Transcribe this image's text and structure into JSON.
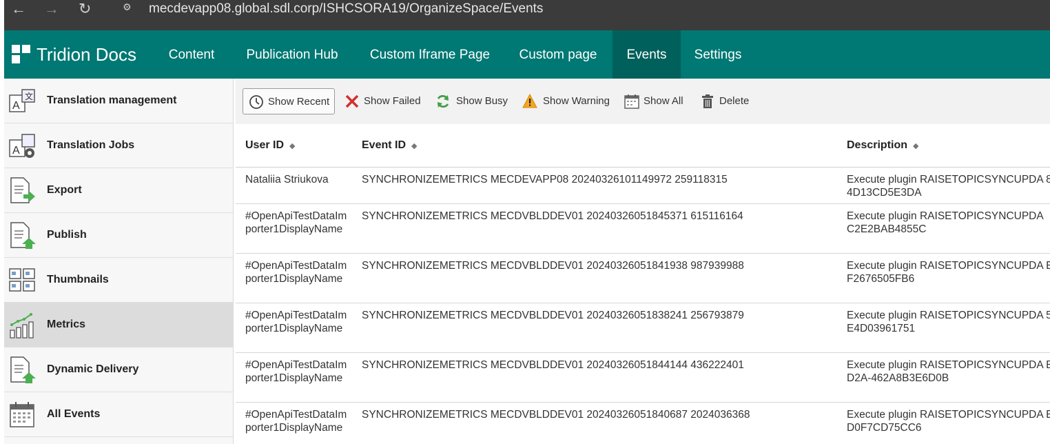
{
  "browser": {
    "url": "mecdevapp08.global.sdl.corp/ISHCSORA19/OrganizeSpace/Events",
    "back_icon": "arrow-left-icon",
    "forward_icon": "arrow-right-icon",
    "reload_icon": "reload-icon"
  },
  "header": {
    "brand": "Tridion Docs",
    "accent": "#007873",
    "active_tab_color": "#00605c",
    "tabs": [
      {
        "label": "Content"
      },
      {
        "label": "Publication Hub"
      },
      {
        "label": "Custom Iframe Page"
      },
      {
        "label": "Custom page"
      },
      {
        "label": "Events",
        "active": true
      },
      {
        "label": "Settings"
      }
    ]
  },
  "sidebar": {
    "items": [
      {
        "label": "Translation management",
        "icon": "translation-icon"
      },
      {
        "label": "Translation Jobs",
        "icon": "translation-jobs-icon"
      },
      {
        "label": "Export",
        "icon": "export-icon"
      },
      {
        "label": "Publish",
        "icon": "publish-icon"
      },
      {
        "label": "Thumbnails",
        "icon": "thumbnails-icon"
      },
      {
        "label": "Metrics",
        "icon": "metrics-icon",
        "active": true
      },
      {
        "label": "Dynamic Delivery",
        "icon": "dynamic-delivery-icon"
      },
      {
        "label": "All Events",
        "icon": "calendar-icon"
      }
    ]
  },
  "toolbar": {
    "buttons": [
      {
        "label": "Show Recent",
        "icon": "clock-icon",
        "selected": true
      },
      {
        "label": "Show Failed",
        "icon": "x-icon"
      },
      {
        "label": "Show Busy",
        "icon": "refresh-icon"
      },
      {
        "label": "Show Warning",
        "icon": "warning-icon"
      },
      {
        "label": "Show All",
        "icon": "calendar-icon"
      },
      {
        "label": "Delete",
        "icon": "trash-icon"
      }
    ]
  },
  "table": {
    "columns": [
      "User ID",
      "Event ID",
      "Description"
    ],
    "rows": [
      {
        "user": "Nataliia Striukova",
        "event": "SYNCHRONIZEMETRICS MECDEVAPP08 20240326101149972 259118315",
        "desc": "Execute plugin RAISETOPICSYNCUPDA 84D13CD5E3DA"
      },
      {
        "user": "#OpenApiTestDataImporter1DisplayName",
        "event": "SYNCHRONIZEMETRICS MECDVBLDDEV01 20240326051845371 615116164",
        "desc": "Execute plugin RAISETOPICSYNCUPDA C2E2BAB4855C"
      },
      {
        "user": "#OpenApiTestDataImporter1DisplayName",
        "event": "SYNCHRONIZEMETRICS MECDVBLDDEV01 20240326051841938 987939988",
        "desc": "Execute plugin RAISETOPICSYNCUPDA EF2676505FB6"
      },
      {
        "user": "#OpenApiTestDataImporter1DisplayName",
        "event": "SYNCHRONIZEMETRICS MECDVBLDDEV01 20240326051838241 256793879",
        "desc": "Execute plugin RAISETOPICSYNCUPDA 5E4D03961751"
      },
      {
        "user": "#OpenApiTestDataImporter1DisplayName",
        "event": "SYNCHRONIZEMETRICS MECDVBLDDEV01 20240326051844144 436222401",
        "desc": "Execute plugin RAISETOPICSYNCUPDA BD2A-462A8B3E6D0B"
      },
      {
        "user": "#OpenApiTestDataImporter1DisplayName",
        "event": "SYNCHRONIZEMETRICS MECDVBLDDEV01 20240326051840687 2024036368",
        "desc": "Execute plugin RAISETOPICSYNCUPDA ED0F7CD75CC6"
      }
    ]
  }
}
